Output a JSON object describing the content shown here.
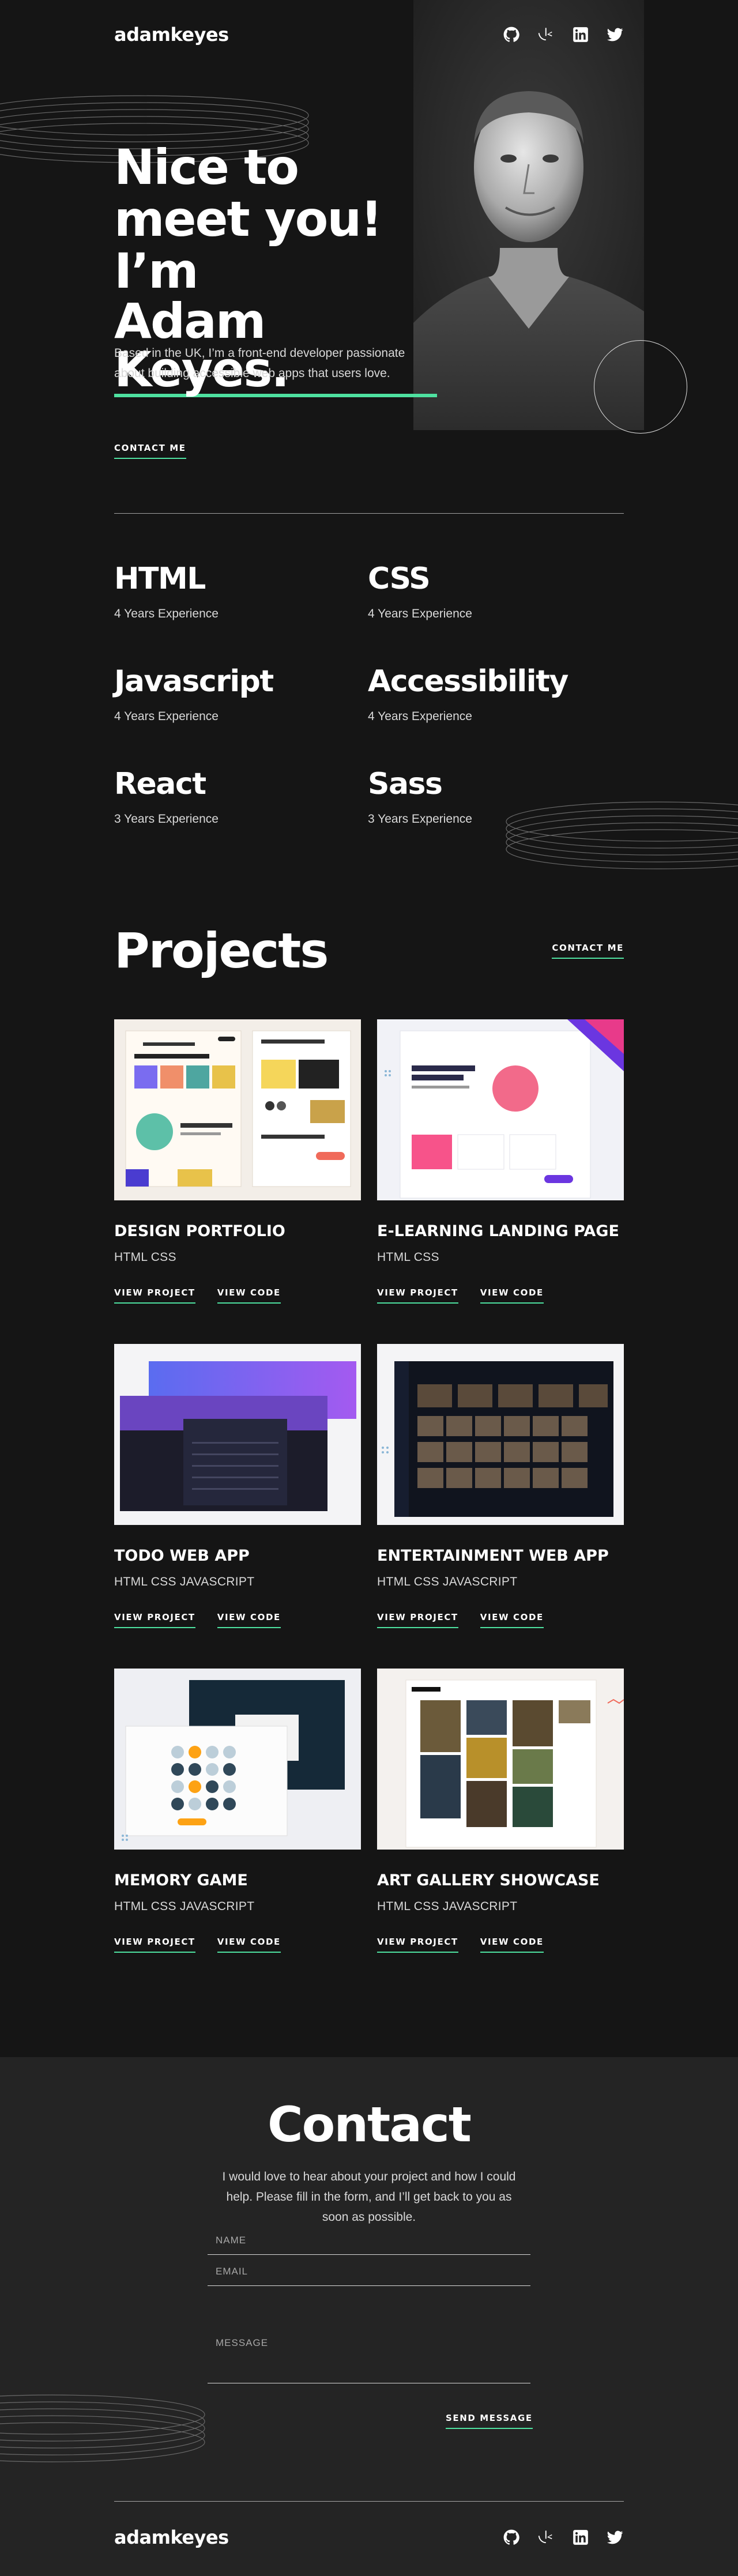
{
  "header": {
    "logo": "adamkeyes",
    "socials": [
      {
        "name": "github-icon"
      },
      {
        "name": "frontend-mentor-icon"
      },
      {
        "name": "linkedin-icon"
      },
      {
        "name": "twitter-icon"
      }
    ]
  },
  "hero": {
    "title_line1": "Nice to",
    "title_line2": "meet you! I’m",
    "title_name": "Adam Keyes.",
    "intro": "Based in the UK, I’m a front-end developer passionate about building accessible web apps that users love.",
    "contact_label": "Contact me"
  },
  "skills": [
    {
      "name": "HTML",
      "experience": "4 Years Experience"
    },
    {
      "name": "CSS",
      "experience": "4 Years Experience"
    },
    {
      "name": "Javascript",
      "experience": "4 Years Experience"
    },
    {
      "name": "Accessibility",
      "experience": "4 Years Experience"
    },
    {
      "name": "React",
      "experience": "3 Years Experience"
    },
    {
      "name": "Sass",
      "experience": "3 Years Experience"
    }
  ],
  "projects": {
    "title": "Projects",
    "contact_label": "Contact me",
    "items": [
      {
        "title": "Design Portfolio",
        "tags": "HTML CSS",
        "view_project": "View project",
        "view_code": "View code"
      },
      {
        "title": "E-Learning Landing Page",
        "tags": "HTML CSS",
        "view_project": "View project",
        "view_code": "View code"
      },
      {
        "title": "Todo Web App",
        "tags": "HTML CSS Javascript",
        "view_project": "View project",
        "view_code": "View code"
      },
      {
        "title": "Entertainment Web App",
        "tags": "HTML CSS Javascript",
        "view_project": "View project",
        "view_code": "View code"
      },
      {
        "title": "Memory Game",
        "tags": "HTML CSS Javascript",
        "view_project": "View project",
        "view_code": "View code"
      },
      {
        "title": "Art Gallery Showcase",
        "tags": "HTML CSS Javascript",
        "view_project": "View project",
        "view_code": "View code"
      }
    ]
  },
  "contact": {
    "title": "Contact",
    "text": "I would love to hear about your project and how I could help. Please fill in the form, and I’ll get back to you as soon as possible.",
    "name_placeholder": "Name",
    "email_placeholder": "Email",
    "message_placeholder": "Message",
    "send_label": "Send message"
  },
  "footer": {
    "logo": "adamkeyes"
  },
  "colors": {
    "accent": "#4ee1a0",
    "background": "#151515",
    "contact_background": "#242424",
    "text_muted": "#d9d9d9"
  }
}
